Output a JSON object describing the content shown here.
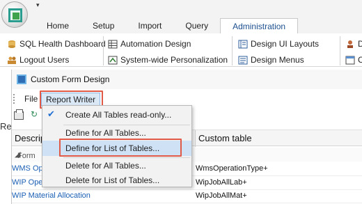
{
  "app": {
    "quick_access": "▾",
    "tabs": [
      "Home",
      "Setup",
      "Import",
      "Query",
      "Administration"
    ],
    "active_tab": "Administration"
  },
  "ribbon": {
    "sql_health": "SQL Health Dashboard",
    "automation": "Automation Design",
    "design_ui": "Design UI Layouts",
    "trunc_d": "D",
    "logout": "Logout Users",
    "personalization": "System-wide Personalization",
    "design_menus": "Design Menus",
    "trunc_c": "C"
  },
  "window": {
    "title": "Custom Form Design",
    "menu": {
      "file": "File",
      "report_writer": "Report Writer"
    },
    "side_label": "Re",
    "grid": {
      "col_description": "Descrip",
      "col_custom_table": "Custom table",
      "group_label": "Form",
      "rows": [
        {
          "description": "WMS Op",
          "custom_table": "WmsOperationType+"
        },
        {
          "description": "WIP Ope",
          "custom_table": "WipJobAllLab+"
        },
        {
          "description": "WIP Material Allocation",
          "custom_table": "WipJobAllMat+"
        }
      ]
    }
  },
  "dropdown": {
    "items": [
      {
        "label": "Create All Tables read-only...",
        "checked": true
      },
      {
        "label": "Define for All Tables...",
        "checked": false
      },
      {
        "label": "Define for List of Tables...",
        "checked": false,
        "highlighted": true
      },
      {
        "label": "Delete for All Tables...",
        "checked": false
      },
      {
        "label": "Delete for List of Tables...",
        "checked": false
      }
    ]
  },
  "colors": {
    "accent": "#1c4f8f",
    "highlight_box": "#e05a47",
    "hover": "#cfe2f5"
  }
}
